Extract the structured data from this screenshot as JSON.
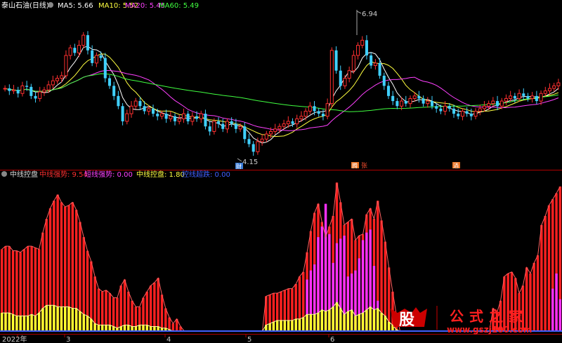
{
  "header": {
    "title": "泰山石油(日线)",
    "ma": [
      {
        "label": "MA5: 5.66",
        "color": "#ffffff"
      },
      {
        "label": "MA10: 5.52",
        "color": "#ffff40"
      },
      {
        "label": "MA20: 5.45",
        "color": "#ff40ff"
      },
      {
        "label": "MA60: 5.49",
        "color": "#40ff40"
      }
    ]
  },
  "indicator": {
    "title": "中线控盘",
    "legend": [
      {
        "label": "中线强势: 9.54",
        "color": "#ff3030"
      },
      {
        "label": "短线强势: 0.00",
        "color": "#ff40ff"
      },
      {
        "label": "中线控盘: 1.80",
        "color": "#ffff40"
      },
      {
        "label": "控线超跌: 0.00",
        "color": "#4060ff"
      }
    ]
  },
  "annotations": {
    "high": "6.94",
    "low": "4.15",
    "marker_low": "财",
    "marker_mid1": "腾",
    "marker_mid2": "张",
    "marker_mid3": "酒"
  },
  "axis": {
    "labels": [
      "2022年",
      "3",
      "4",
      "5",
      "6"
    ]
  },
  "watermark": {
    "logo": "股",
    "text": "公式之家",
    "url": "www.gszj100.com"
  },
  "chart_data": [
    {
      "type": "candlestick",
      "title": "泰山石油(日线)",
      "ylim": [
        4.0,
        7.1
      ],
      "high_label": 6.94,
      "low_label": 4.15,
      "close": [
        5.55,
        5.5,
        5.52,
        5.45,
        5.6,
        5.58,
        5.4,
        5.35,
        5.48,
        5.52,
        5.62,
        5.7,
        5.75,
        5.8,
        6.2,
        6.35,
        6.25,
        6.4,
        6.6,
        6.3,
        6.05,
        6.2,
        6.15,
        5.75,
        5.6,
        5.4,
        5.2,
        4.9,
        5.05,
        5.2,
        5.3,
        5.2,
        5.1,
        5.15,
        5.05,
        5.0,
        5.05,
        4.95,
        5.0,
        4.9,
        4.95,
        5.05,
        4.9,
        5.0,
        4.95,
        5.05,
        4.8,
        4.7,
        4.9,
        4.85,
        4.75,
        4.9,
        4.85,
        4.75,
        4.8,
        4.55,
        4.45,
        4.3,
        4.5,
        4.55,
        4.65,
        4.7,
        4.75,
        4.8,
        4.85,
        4.9,
        4.85,
        4.95,
        5.0,
        5.1,
        5.2,
        5.1,
        5.05,
        5.0,
        5.25,
        6.3,
        5.9,
        5.6,
        5.75,
        5.9,
        6.2,
        6.4,
        6.5,
        6.2,
        6.0,
        6.05,
        5.8,
        5.6,
        5.4,
        5.3,
        5.2,
        5.3,
        5.25,
        5.35,
        5.4,
        5.35,
        5.25,
        5.3,
        5.2,
        5.15,
        5.1,
        5.2,
        5.15,
        5.05,
        5.0,
        5.1,
        5.05,
        5.0,
        5.1,
        5.15,
        5.2,
        5.25,
        5.3,
        5.2,
        5.3,
        5.35,
        5.4,
        5.35,
        5.45,
        5.4,
        5.35,
        5.4,
        5.3,
        5.45,
        5.5,
        5.55,
        5.6,
        5.66
      ],
      "series": [
        {
          "name": "MA5",
          "color": "#ffffff"
        },
        {
          "name": "MA10",
          "color": "#ffff40"
        },
        {
          "name": "MA20",
          "color": "#ff40ff"
        },
        {
          "name": "MA60",
          "color": "#40ff40"
        }
      ]
    },
    {
      "type": "bar",
      "title": "中线控盘",
      "ylim": [
        0,
        10
      ],
      "series": [
        {
          "name": "中线强势",
          "color": "#ff2020",
          "values": [
            5.4,
            5.6,
            5.6,
            5.3,
            5.3,
            5.2,
            5.4,
            5.6,
            5.6,
            5.5,
            5.4,
            6.5,
            7.4,
            8.1,
            8.6,
            9.0,
            8.5,
            8.2,
            8.3,
            8.5,
            8.0,
            7.2,
            6.2,
            5.3,
            4.6,
            3.6,
            2.8,
            2.6,
            2.7,
            2.5,
            2.2,
            2.2,
            3.0,
            3.4,
            2.6,
            2.0,
            1.6,
            1.6,
            2.2,
            2.6,
            3.0,
            3.2,
            3.5,
            2.4,
            1.5,
            0.9,
            0.5,
            0.8,
            0.3,
            0,
            0,
            0,
            0,
            0,
            0,
            0,
            0,
            0,
            0,
            0,
            0,
            0,
            0,
            0,
            0,
            0,
            0,
            0,
            0,
            0,
            0,
            2.3,
            2.4,
            2.5,
            2.5,
            2.6,
            2.7,
            2.8,
            2.8,
            3.1,
            3.6,
            3.9,
            5.2,
            6.6,
            7.8,
            8.4,
            7.2,
            6.2,
            6.9,
            7.6,
            9.8,
            8.5,
            7.0,
            7.2,
            7.4,
            6.0,
            6.3,
            6.4,
            7.7,
            8.1,
            7.4,
            8.6,
            7.3,
            5.9,
            4.2,
            2.6,
            1.1,
            0,
            0,
            0,
            0,
            0,
            0,
            0,
            0,
            0,
            0,
            0,
            0,
            0,
            0,
            0,
            0,
            0,
            0,
            0,
            0,
            0,
            0,
            0,
            0,
            0,
            1.5,
            1.2,
            2.0,
            3.6,
            3.8,
            3.9,
            3.5,
            2.5,
            3.0,
            4.2,
            3.8,
            4.5,
            5.0,
            7.0,
            7.6,
            8.3,
            8.7,
            9.1,
            9.54
          ]
        },
        {
          "name": "短线强势",
          "color": "#ff30ff",
          "values": [
            0,
            0,
            0,
            0,
            0,
            0,
            0,
            0,
            0,
            0,
            0,
            0,
            0,
            0,
            0,
            0,
            0,
            0,
            0,
            0,
            0,
            0,
            0,
            0,
            0,
            0,
            0,
            0,
            0,
            0,
            0,
            0,
            0,
            0,
            0,
            0,
            0,
            0,
            0,
            0,
            0,
            0,
            0,
            0,
            0,
            0,
            0,
            0,
            0,
            0,
            0,
            0,
            0,
            0,
            0,
            0,
            0,
            0,
            0,
            0,
            0,
            0,
            0,
            0,
            0,
            0,
            0,
            0,
            0,
            0,
            0,
            0,
            0,
            0,
            0,
            0,
            0,
            0,
            0,
            0,
            0,
            0,
            3.4,
            4.0,
            4.4,
            6.2,
            6.9,
            8.4,
            6.4,
            4.5,
            5.8,
            6.1,
            6.3,
            3.6,
            3.8,
            4.0,
            4.8,
            6.0,
            6.5,
            6.7,
            4.3,
            2.0,
            0,
            0,
            0,
            0,
            0,
            0,
            0,
            0,
            0,
            0,
            0,
            0,
            0,
            0,
            0,
            0,
            0,
            0,
            0,
            0,
            0,
            0,
            0,
            0,
            0,
            0,
            0,
            0,
            0,
            0,
            0,
            0,
            0,
            0,
            0,
            0,
            0,
            0,
            0,
            0,
            0,
            0,
            0,
            0,
            0,
            0,
            2.8,
            3.8,
            2.1,
            0
          ]
        },
        {
          "name": "中线控盘",
          "color": "#ffff30",
          "values": [
            1.2,
            1.2,
            1.2,
            1.1,
            1.0,
            1.0,
            1.0,
            1.0,
            1.1,
            1.0,
            1.2,
            1.5,
            1.7,
            1.7,
            1.7,
            1.6,
            1.6,
            1.6,
            1.6,
            1.5,
            1.5,
            1.3,
            1.1,
            1.0,
            0.8,
            0.5,
            0.4,
            0.4,
            0.4,
            0.4,
            0.3,
            0.2,
            0.3,
            0.4,
            0.4,
            0.3,
            0.3,
            0.4,
            0.4,
            0.4,
            0.3,
            0.3,
            0.3,
            0.2,
            0.2,
            0.1,
            0,
            0,
            0,
            0,
            0,
            0,
            0,
            0,
            0,
            0,
            0,
            0,
            0,
            0,
            0,
            0,
            0,
            0,
            0,
            0,
            0,
            0,
            0,
            0,
            0,
            0.4,
            0.5,
            0.6,
            0.7,
            0.7,
            0.7,
            0.7,
            0.7,
            0.8,
            0.8,
            0.9,
            1.1,
            1.1,
            1.1,
            1.2,
            1.4,
            1.3,
            1.4,
            1.6,
            1.9,
            1.5,
            1.1,
            1.3,
            1.4,
            1.0,
            1.1,
            1.2,
            1.4,
            1.6,
            1.4,
            1.5,
            1.2,
            1.0,
            0.6,
            0.4,
            0.1,
            0,
            0,
            0,
            0,
            0,
            0,
            0,
            0,
            0,
            0,
            0,
            0,
            0,
            0,
            0,
            0,
            0,
            0,
            0,
            0,
            0,
            0,
            0,
            0,
            0,
            0,
            0,
            0,
            0,
            0,
            0,
            0,
            0,
            0,
            0,
            0,
            0,
            0,
            0,
            0,
            0,
            0,
            0,
            0,
            0,
            1.8
          ]
        },
        {
          "name": "控线超跌",
          "color": "#4060ff",
          "values": []
        }
      ]
    }
  ]
}
